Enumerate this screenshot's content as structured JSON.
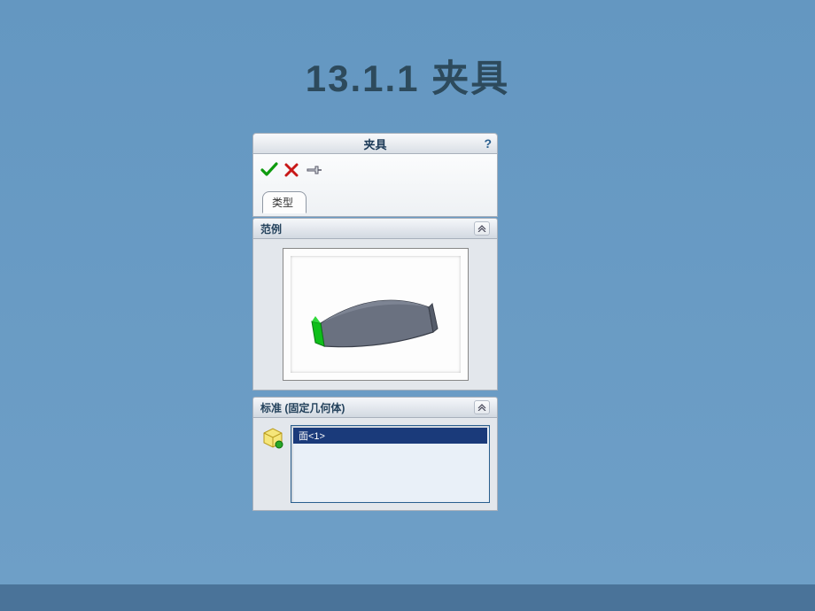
{
  "page": {
    "title": "13.1.1  夹具"
  },
  "panel": {
    "title": "夹具",
    "help": "?",
    "tab_label": "类型"
  },
  "sections": {
    "example": {
      "title": "范例"
    },
    "standard": {
      "title": "标准 (固定几何体)"
    }
  },
  "selection": {
    "items": [
      "面<1>"
    ]
  },
  "icons": {
    "ok": "ok-check-icon",
    "cancel": "cancel-x-icon",
    "pin": "pin-icon",
    "chevron": "chevron-up-icon",
    "face": "face-select-icon",
    "help": "help-icon"
  }
}
